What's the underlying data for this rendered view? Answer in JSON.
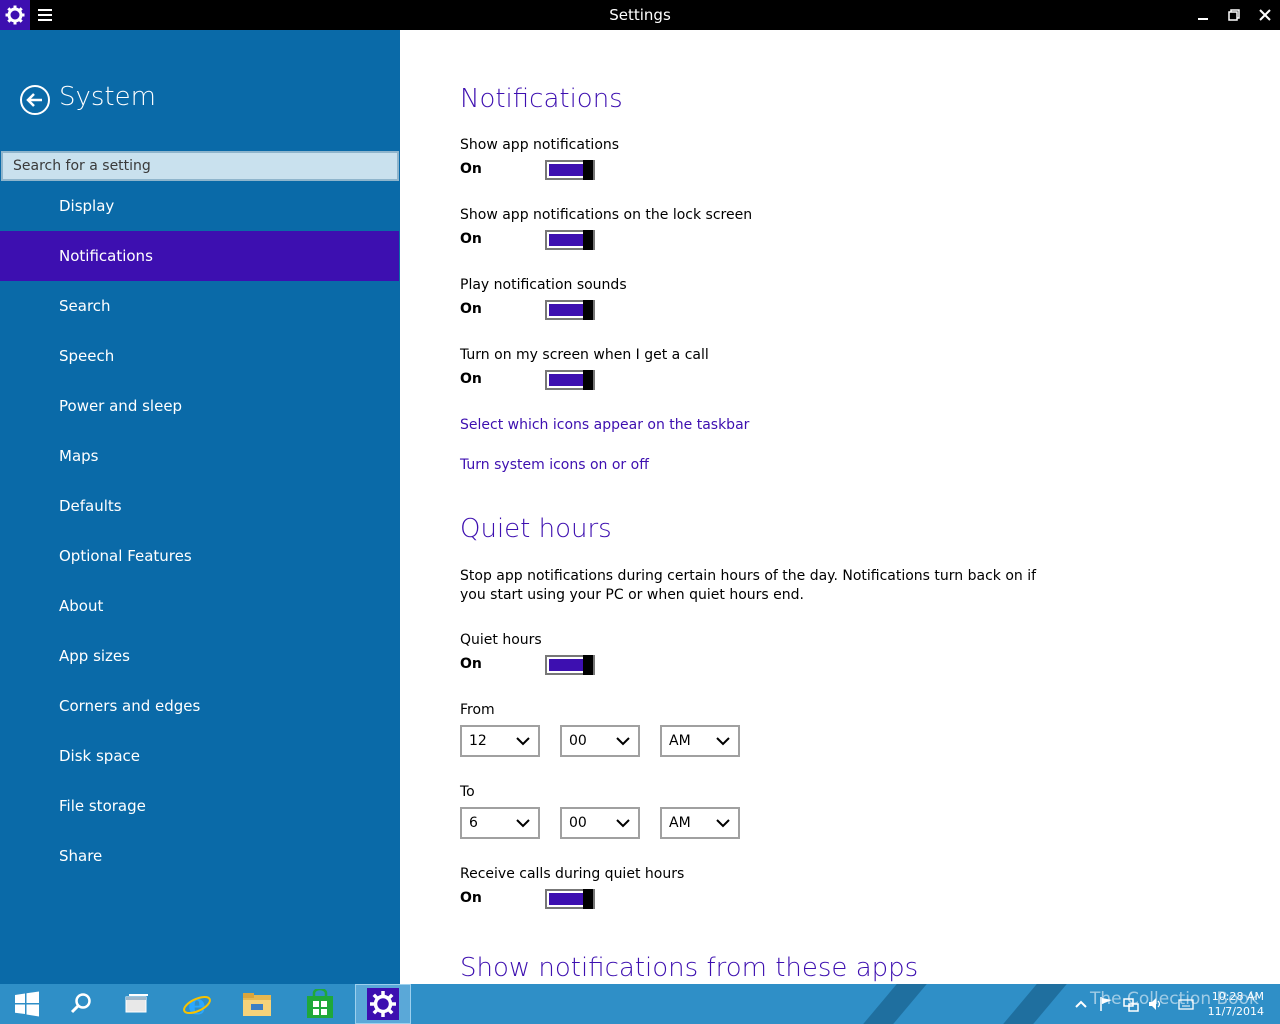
{
  "window": {
    "title": "Settings",
    "minimize_icon": "minimize-icon",
    "maximize_icon": "restore-icon",
    "close_icon": "close-icon"
  },
  "sidebar": {
    "title": "System",
    "search_placeholder": "Search for a setting",
    "items": [
      {
        "label": "Display"
      },
      {
        "label": "Notifications",
        "active": true
      },
      {
        "label": "Search"
      },
      {
        "label": "Speech"
      },
      {
        "label": "Power and sleep"
      },
      {
        "label": "Maps"
      },
      {
        "label": "Defaults"
      },
      {
        "label": "Optional Features"
      },
      {
        "label": "About"
      },
      {
        "label": "App sizes"
      },
      {
        "label": "Corners and edges"
      },
      {
        "label": "Disk space"
      },
      {
        "label": "File storage"
      },
      {
        "label": "Share"
      }
    ]
  },
  "notifications": {
    "heading": "Notifications",
    "toggles": [
      {
        "label": "Show app notifications",
        "state": "On"
      },
      {
        "label": "Show app notifications on the lock screen",
        "state": "On"
      },
      {
        "label": "Play notification sounds",
        "state": "On"
      },
      {
        "label": "Turn on my screen when I get a call",
        "state": "On"
      }
    ],
    "links": [
      "Select which icons appear on the taskbar",
      "Turn system icons on or off"
    ]
  },
  "quiet_hours": {
    "heading": "Quiet hours",
    "description": "Stop app notifications during certain hours of the day. Notifications turn back on if you start using your PC or when quiet hours end.",
    "toggle_label": "Quiet hours",
    "toggle_state": "On",
    "from_label": "From",
    "from": {
      "hour": "12",
      "minute": "00",
      "period": "AM"
    },
    "to_label": "To",
    "to": {
      "hour": "6",
      "minute": "00",
      "period": "AM"
    },
    "calls_label": "Receive calls during quiet hours",
    "calls_state": "On"
  },
  "apps_section": {
    "heading": "Show notifications from these apps"
  },
  "taskbar": {
    "time": "10:28 AM",
    "date": "11/7/2014",
    "watermark": "The Collection Book"
  },
  "colors": {
    "accent": "#3d0fb0",
    "sidebar": "#0a6aa8",
    "taskbar": "#2f8fc7"
  }
}
